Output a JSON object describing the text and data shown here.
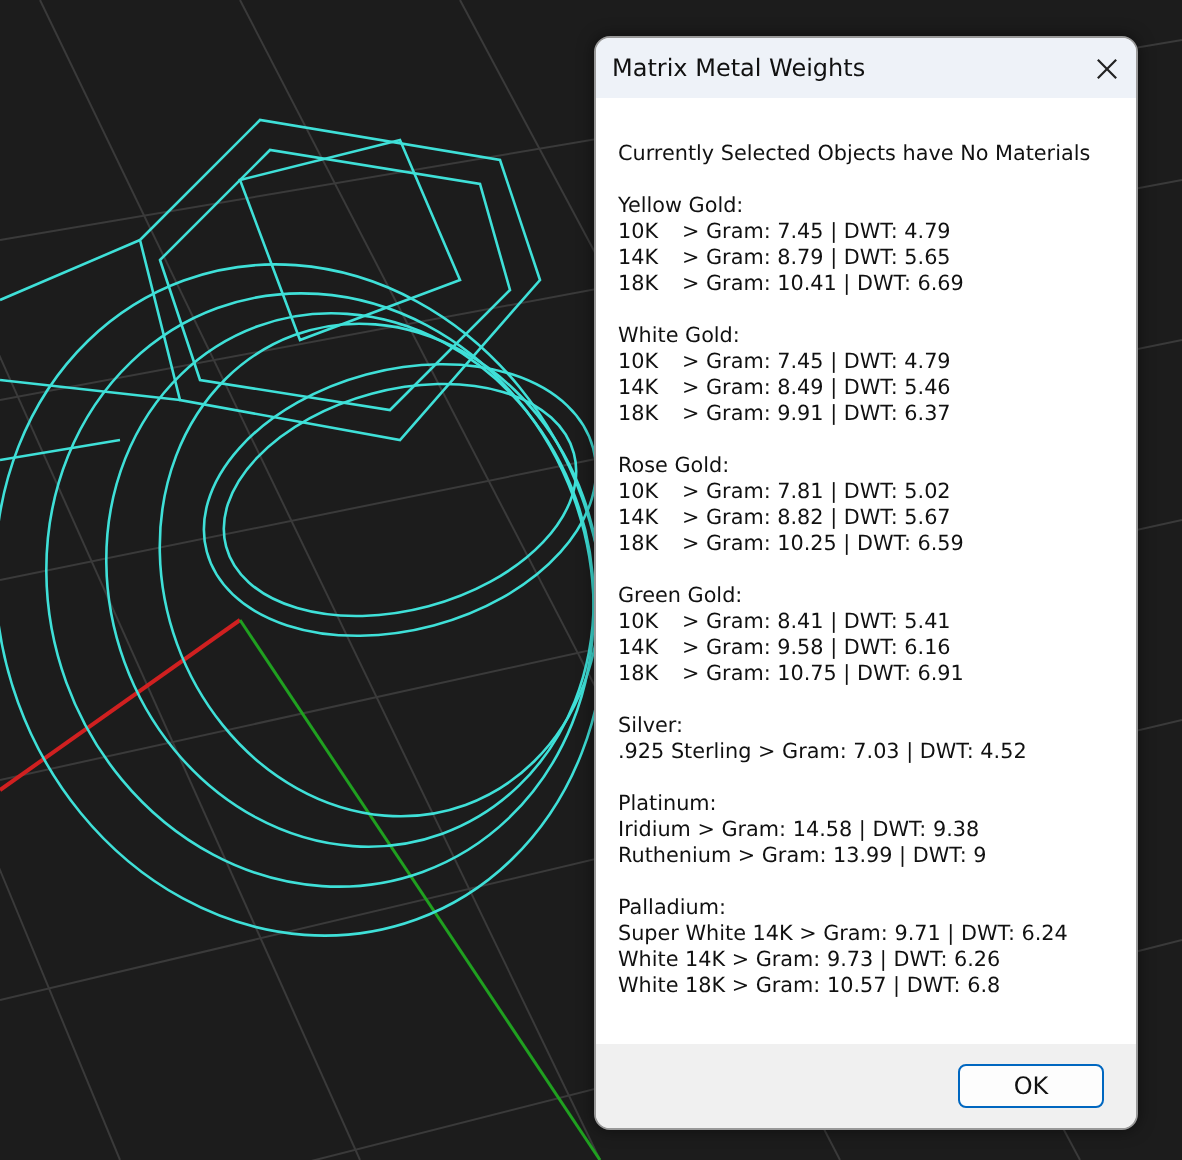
{
  "window": {
    "title": "Matrix Metal Weights"
  },
  "message": "Currently Selected Objects have No Materials",
  "sections": [
    {
      "heading": "Yellow Gold:",
      "lines": [
        "10K\t> Gram: 7.45 | DWT: 4.79",
        "14K\t> Gram: 8.79 | DWT: 5.65",
        "18K\t> Gram: 10.41 | DWT: 6.69"
      ]
    },
    {
      "heading": "White Gold:",
      "lines": [
        "10K\t> Gram: 7.45 | DWT: 4.79",
        "14K\t> Gram: 8.49 | DWT: 5.46",
        "18K\t> Gram: 9.91 | DWT: 6.37"
      ]
    },
    {
      "heading": "Rose Gold:",
      "lines": [
        "10K\t> Gram: 7.81 | DWT: 5.02",
        "14K\t> Gram: 8.82 | DWT: 5.67",
        "18K\t> Gram: 10.25 | DWT: 6.59"
      ]
    },
    {
      "heading": "Green Gold:",
      "lines": [
        "10K\t> Gram: 8.41 | DWT: 5.41",
        "14K\t> Gram: 9.58 | DWT: 6.16",
        "18K\t> Gram: 10.75 | DWT: 6.91"
      ]
    },
    {
      "heading": "Silver:",
      "lines": [
        ".925 Sterling > Gram: 7.03 | DWT: 4.52"
      ]
    },
    {
      "heading": "Platinum:",
      "lines": [
        "Iridium > Gram: 14.58 | DWT: 9.38",
        "Ruthenium > Gram: 13.99 | DWT: 9"
      ]
    },
    {
      "heading": "Palladium:",
      "lines": [
        "Super White 14K > Gram: 9.71 | DWT: 6.24",
        "White 14K > Gram: 9.73 | DWT: 6.26",
        "White 18K > Gram: 10.57 | DWT: 6.8"
      ]
    }
  ],
  "buttons": [
    "OK"
  ]
}
